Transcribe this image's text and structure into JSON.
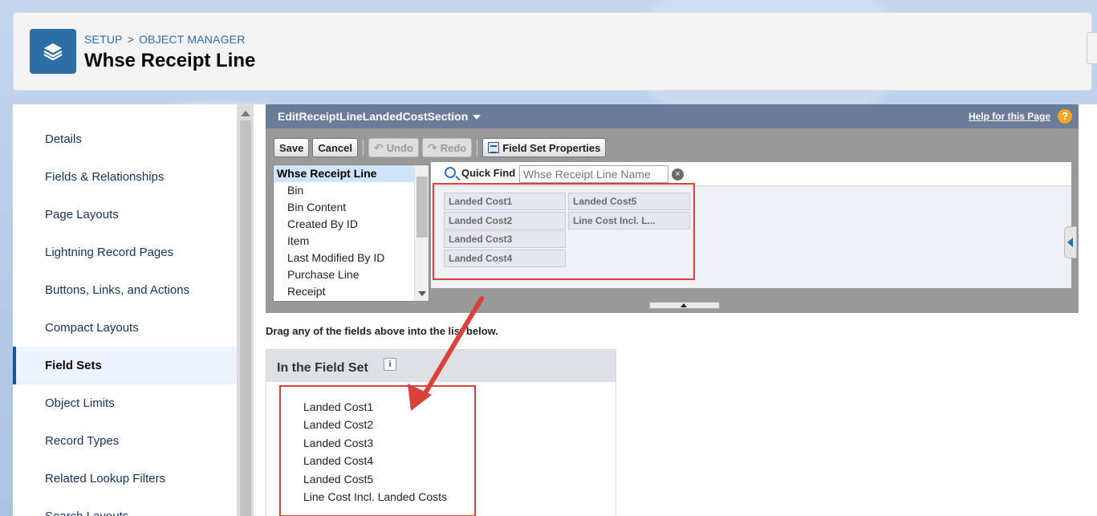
{
  "breadcrumb": {
    "setup": "SETUP",
    "separator": ">",
    "object_manager": "OBJECT MANAGER"
  },
  "page_title": "Whse Receipt Line",
  "sidebar": {
    "items": [
      {
        "label": "Details",
        "active": false
      },
      {
        "label": "Fields & Relationships",
        "active": false
      },
      {
        "label": "Page Layouts",
        "active": false
      },
      {
        "label": "Lightning Record Pages",
        "active": false
      },
      {
        "label": "Buttons, Links, and Actions",
        "active": false
      },
      {
        "label": "Compact Layouts",
        "active": false
      },
      {
        "label": "Field Sets",
        "active": true
      },
      {
        "label": "Object Limits",
        "active": false
      },
      {
        "label": "Record Types",
        "active": false
      },
      {
        "label": "Related Lookup Filters",
        "active": false
      },
      {
        "label": "Search Layouts",
        "active": false
      }
    ]
  },
  "editor": {
    "title": "EditReceiptLineLandedCostSection",
    "help_link": "Help for this Page",
    "help_icon": "?",
    "toolbar": {
      "save": "Save",
      "cancel": "Cancel",
      "undo": "Undo",
      "redo": "Redo",
      "field_set_properties": "Field Set Properties"
    },
    "field_list": [
      "Whse Receipt Line",
      "Bin",
      "Bin Content",
      "Created By ID",
      "Item",
      "Last Modified By ID",
      "Purchase Line",
      "Receipt"
    ],
    "quick_find": {
      "label": "Quick Find",
      "placeholder": "Whse Receipt Line Name",
      "clear_icon": "×"
    },
    "palette_fields": {
      "col1": [
        "Landed Cost1",
        "Landed Cost2",
        "Landed Cost3",
        "Landed Cost4"
      ],
      "col2": [
        "Landed Cost5",
        "Line Cost Incl. L..."
      ]
    }
  },
  "drag_hint": "Drag any of the fields above into the list below.",
  "field_set_panel": {
    "title": "In the Field Set",
    "info_icon": "i",
    "items": [
      "Landed Cost1",
      "Landed Cost2",
      "Landed Cost3",
      "Landed Cost4",
      "Landed Cost5",
      "Line Cost Incl. Landed Costs"
    ]
  },
  "colors": {
    "accent": "#2e6ea6",
    "highlight_red": "#d9413b",
    "editor_header": "#6b7b9a"
  },
  "icons": {
    "app": "layers-icon",
    "quick_find": "magnifier-icon",
    "info": "info-icon"
  }
}
